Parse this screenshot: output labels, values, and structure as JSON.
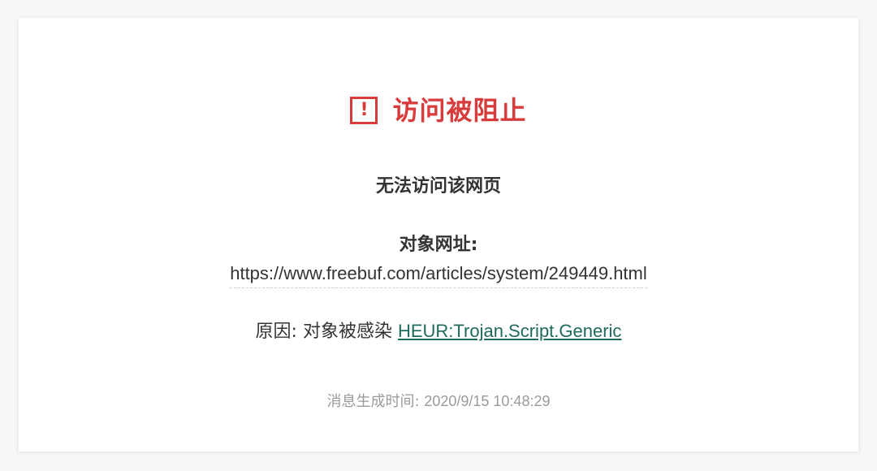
{
  "page": {
    "title": "访问被阻止",
    "icon": "alert-icon",
    "icon_glyph": "!",
    "accent_color": "#d83b3b",
    "link_color": "#1e6b5e"
  },
  "message": {
    "subtitle": "无法访问该网页",
    "target_label": "对象网址:",
    "target_url": "https://www.freebuf.com/articles/system/249449.html",
    "reason_label": "原因: 对象被感染",
    "reason_link": "HEUR:Trojan.Script.Generic",
    "timestamp_label": "消息生成时间:",
    "timestamp_value": "2020/9/15 10:48:29"
  }
}
